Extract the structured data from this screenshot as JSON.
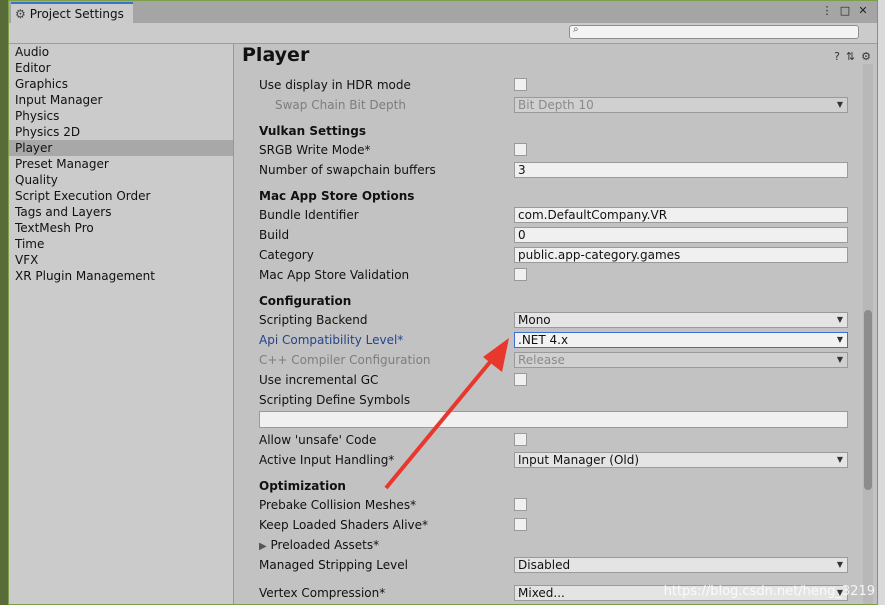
{
  "window": {
    "title": "Project Settings",
    "title_icon": "gear-icon",
    "controls": [
      "more-icon",
      "maximize-icon",
      "close-icon"
    ]
  },
  "search": {
    "placeholder": "",
    "icon": "search-icon"
  },
  "sidebar": {
    "items": [
      {
        "label": "Audio"
      },
      {
        "label": "Editor"
      },
      {
        "label": "Graphics"
      },
      {
        "label": "Input Manager"
      },
      {
        "label": "Physics"
      },
      {
        "label": "Physics 2D"
      },
      {
        "label": "Player",
        "selected": true
      },
      {
        "label": "Preset Manager"
      },
      {
        "label": "Quality"
      },
      {
        "label": "Script Execution Order"
      },
      {
        "label": "Tags and Layers"
      },
      {
        "label": "TextMesh Pro"
      },
      {
        "label": "Time"
      },
      {
        "label": "VFX"
      },
      {
        "label": "XR Plugin Management"
      }
    ]
  },
  "main": {
    "title": "Player",
    "header_icons": [
      "help-icon",
      "preset-icon",
      "settings-icon"
    ],
    "rows": {
      "hdr_display": "Use display in HDR mode",
      "swap_chain_depth": "Swap Chain Bit Depth",
      "swap_chain_value": "Bit Depth 10",
      "vulkan_section": "Vulkan Settings",
      "srgb_write": "SRGB Write Mode*",
      "swapchain_buffers": "Number of swapchain buffers",
      "swapchain_buffers_value": "3",
      "mac_section": "Mac App Store Options",
      "bundle_id": "Bundle Identifier",
      "bundle_id_value": "com.DefaultCompany.VR",
      "build": "Build",
      "build_value": "0",
      "category": "Category",
      "category_value": "public.app-category.games",
      "mac_validation": "Mac App Store Validation",
      "config_section": "Configuration",
      "scripting_backend": "Scripting Backend",
      "scripting_backend_value": "Mono",
      "api_level": "Api Compatibility Level*",
      "api_level_value": ".NET 4.x",
      "cpp_config": "C++ Compiler Configuration",
      "cpp_config_value": "Release",
      "incremental_gc": "Use incremental GC",
      "define_symbols": "Scripting Define Symbols",
      "define_symbols_value": "",
      "unsafe_code": "Allow 'unsafe' Code",
      "input_handling": "Active Input Handling*",
      "input_handling_value": "Input Manager (Old)",
      "opt_section": "Optimization",
      "prebake": "Prebake Collision Meshes*",
      "keep_shaders": "Keep Loaded Shaders Alive*",
      "preloaded_assets": "Preloaded Assets*",
      "stripping_level": "Managed Stripping Level",
      "stripping_level_value": "Disabled",
      "vertex_compression": "Vertex Compression*",
      "vertex_compression_value": "Mixed..."
    }
  },
  "watermark": "https://blog.csdn.net/heng_3219",
  "colors": {
    "accent": "#3a72c8",
    "annotation_arrow": "#e8372c",
    "link_label": "#24448c"
  }
}
